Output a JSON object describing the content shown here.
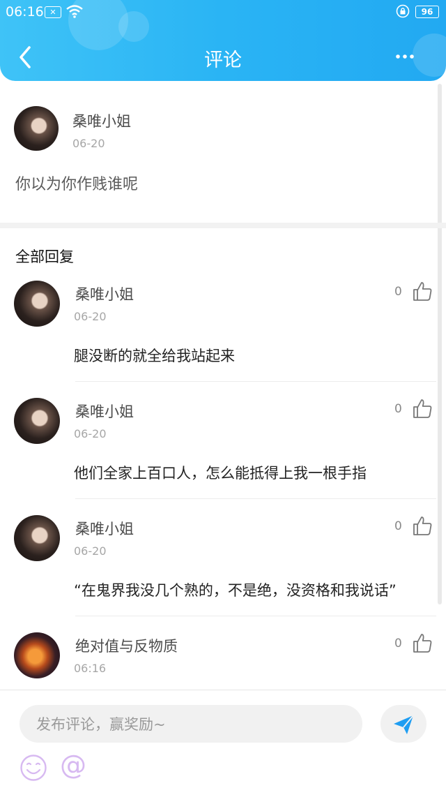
{
  "status_bar": {
    "time": "06:16",
    "battery": "96"
  },
  "header": {
    "title": "评论"
  },
  "main_comment": {
    "author": "桑唯小姐",
    "date": "06-20",
    "text": "你以为你作贱谁呢"
  },
  "replies_section": {
    "title": "全部回复"
  },
  "replies": [
    {
      "author": "桑唯小姐",
      "date": "06-20",
      "likes": "0",
      "text": "腿没断的就全给我站起来"
    },
    {
      "author": "桑唯小姐",
      "date": "06-20",
      "likes": "0",
      "text": "他们全家上百口人，怎么能抵得上我一根手指"
    },
    {
      "author": "桑唯小姐",
      "date": "06-20",
      "likes": "0",
      "text": "“在鬼界我没几个熟的，不是绝，没资格和我说话”"
    },
    {
      "author": "绝对值与反物质",
      "date": "06:16",
      "likes": "0",
      "text": ""
    }
  ],
  "input_bar": {
    "placeholder": "发布评论，赢奖励~"
  },
  "icons": {
    "back": "back-arrow-icon",
    "more": "more-icon",
    "like": "thumbs-up-icon",
    "send": "send-icon",
    "emoji": "emoji-icon",
    "mention": "at-icon"
  },
  "colors": {
    "header": "#2ab4f4",
    "send": "#1e9df2",
    "emoji": "#d7b9f1"
  }
}
